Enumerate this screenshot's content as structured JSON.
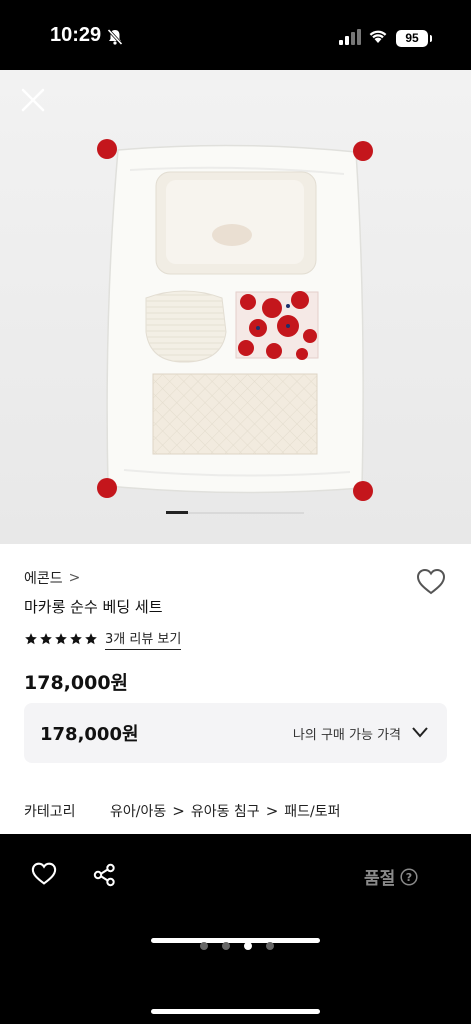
{
  "status_bar": {
    "time": "10:29",
    "battery": "95"
  },
  "hero": {
    "close_icon": "close-icon",
    "carousel_position": 0.16
  },
  "product": {
    "brand": "에콘드",
    "brand_chevron": ">",
    "title": "마카롱 순수 베딩 세트",
    "rating_stars": 5,
    "review_link": "3개 리뷰 보기",
    "price": "178,000원"
  },
  "price_box": {
    "value": "178,000원",
    "label": "나의 구매 가능 가격"
  },
  "category": {
    "label": "카테고리",
    "path": [
      "유아/아동",
      "유아동 침구",
      "패드/토퍼"
    ],
    "separator": ">"
  },
  "bottom_bar": {
    "soldout_label": "품절",
    "icons": [
      "heart-icon",
      "share-icon",
      "help-icon"
    ]
  },
  "colors": {
    "accent_red": "#c4161c",
    "text_primary": "#111111",
    "soldout_gray": "#8a8a8a",
    "price_box_bg": "#f4f4f6"
  }
}
